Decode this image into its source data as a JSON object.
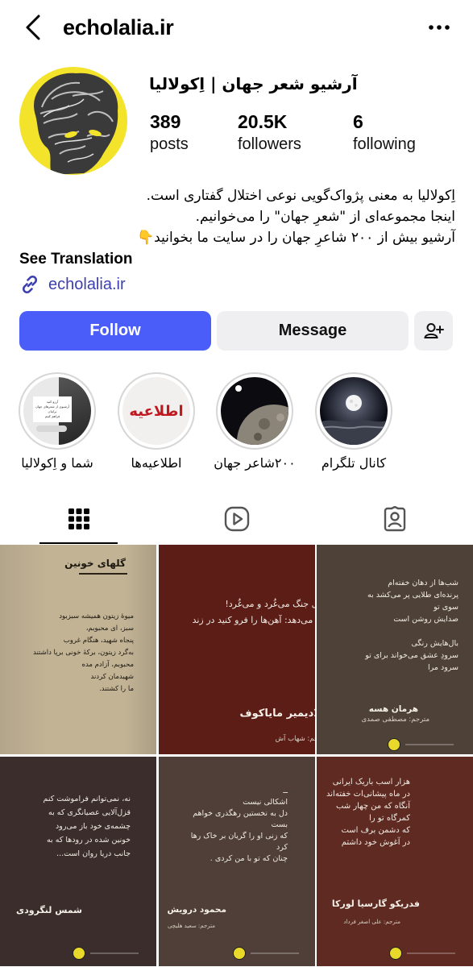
{
  "header": {
    "username": "echolalia.ir"
  },
  "profile": {
    "display_name": "آرشیو شعر جهان | اِکولالیا",
    "stats": [
      {
        "value": "389",
        "label": "posts"
      },
      {
        "value": "20.5K",
        "label": "followers"
      },
      {
        "value": "6",
        "label": "following"
      }
    ],
    "bio": [
      "اِکولالیا به معنی پژواک‌گویی نوعی اختلال گفتاری است.",
      "اینجا مجموعه‌ای از \"شعرِ جهان\" را می‌خوانیم.",
      "آرشیو بیش از ۲۰۰ شاعرِ جهان را در سایت ما بخوانید👇"
    ],
    "see_translation": "See Translation",
    "link": "echolalia.ir"
  },
  "actions": {
    "follow": "Follow",
    "message": "Message"
  },
  "highlights": [
    {
      "label": "شما و اِکولالیا",
      "story_line1": "آرزو کنید",
      "story_line2": "آرشیوی از شعرهای جهان برایتان",
      "story_line3": "فراهم کنیم"
    },
    {
      "label": "اطلاعیه‌ها",
      "badge": "اطلاعیه"
    },
    {
      "label": "۲۰۰شاعر جهان"
    },
    {
      "label": "کانال تلگرام"
    }
  ],
  "posts": [
    {
      "title": "گلهای خونین",
      "lines": "میوهٔ زیتون همیشه سبزبود\nسبز، ای محبوبم،\nپنجاه شهید، هنگام غروب\nبه‌گرد زیتون، برکهٔ خونی برپا داشتند\nمحبوبم، آزادم مده\nشهیدمان کردند\nما را کشتند."
    },
    {
      "lines": "طبل جنگ می‌غُرد و می‌غُرد!\nسر می‌دهد: آهن‌ها را فرو کنید در زند",
      "poet": "ولادیمیر مایاکوف",
      "translator": "مترجم: شهاب آش"
    },
    {
      "lines": "شب‌ها از دهان خفته‌ام\nپرنده‌ای طلایی پر می‌کشد به\nسوی تو\nصدایش روشن است\n\nبال‌هایش رنگی\nسرودِ عشق می‌خواند برای تو\nسرود مرا",
      "poet": "هرمان هسه",
      "translator": "مترجم: مصطفی صمدی"
    },
    {
      "lines": "نه، نمی‌توانم فراموشت کنم\nقزل‌آلایی عصیانگری که به\nچشمه‌ی خود باز می‌رود\nخونین شده در رودها که به\nجانب دریا روان است...",
      "poet": "شمس لنگرودی"
    },
    {
      "lines": "ــ\nاشکالی نیست\nدل به نخستین رهگذری خواهم\nبست\nکه زنی او را گریان بر خاک رها\nکرد\nچنان که تو با من کردی .",
      "poet": "محمود درویش",
      "translator": "مترجم: سعید هلیچی"
    },
    {
      "lines": "هزار اسب باریک ایرانی\nدر ماه پیشانی‌ات خفته‌اند\nآنگاه که من چهار شب\nکمرگاه تو را\nکه دشمن برف است\nدر آغوش خود داشتم",
      "poet": "فدریکو گارسیا لورکا",
      "translator": "مترجم: علی اصغر فرداد"
    }
  ],
  "colors": {
    "follow_bg": "#4a5df9",
    "button_gray": "#efeff1",
    "link": "#3c3fb0",
    "avatar_bg": "#f3e32b"
  }
}
